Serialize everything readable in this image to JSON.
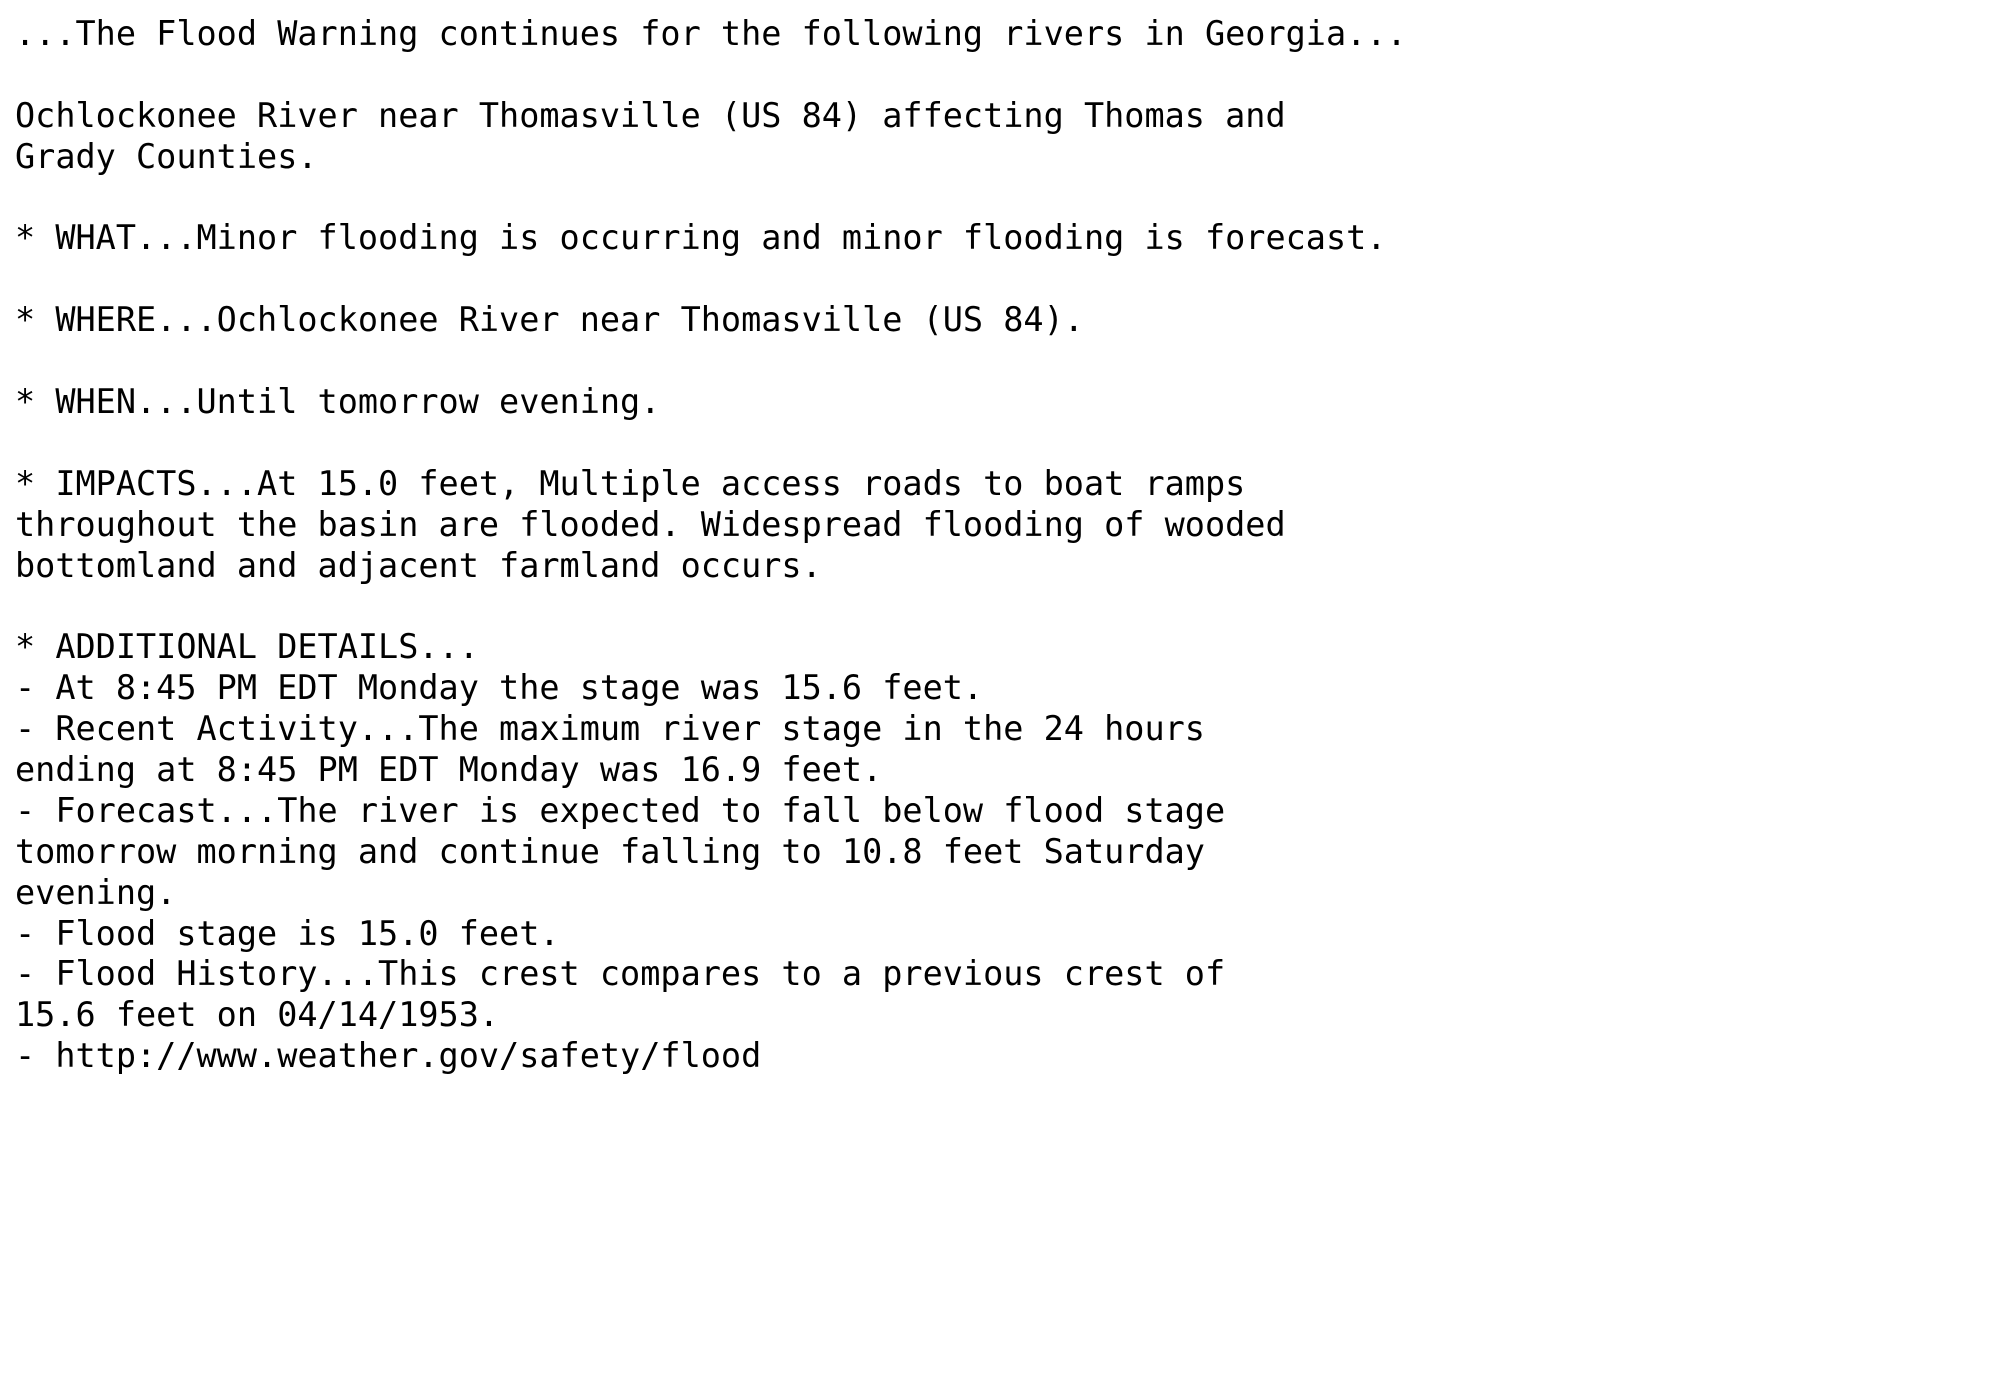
{
  "document": {
    "kind": "nws-flood-warning-bulletin",
    "background_color": "#ffffff",
    "text_color": "#000000",
    "headline": "...The Flood Warning continues for the following rivers in Georgia...",
    "river_location": "Ochlockonee River near Thomasville (US 84) affecting Thomas and Grady Counties.",
    "sections": {
      "what": "* WHAT...Minor flooding is occurring and minor flooding is forecast.",
      "where": "* WHERE...Ochlockonee River near Thomasville (US 84).",
      "when": "* WHEN...Until tomorrow evening.",
      "impacts": "* IMPACTS...At 15.0 feet, Multiple access roads to boat ramps throughout the basin are flooded. Widespread flooding of wooded bottomland and adjacent farmland occurs.",
      "additional_details_header": "* ADDITIONAL DETAILS...",
      "additional_details": [
        "- At 8:45 PM EDT Monday the stage was 15.6 feet.",
        "- Recent Activity...The maximum river stage in the 24 hours ending at 8:45 PM EDT Monday was 16.9 feet.",
        "- Forecast...The river is expected to fall below flood stage tomorrow morning and continue falling to 10.8 feet Saturday evening.",
        "- Flood stage is 15.0 feet.",
        "- Flood History...This crest compares to a previous crest of 15.6 feet on 04/14/1953.",
        "- http://www.weather.gov/safety/flood"
      ]
    },
    "values": {
      "flood_stage_feet": "15.0",
      "current_stage_feet": "15.6",
      "max_stage_24h_feet": "16.9",
      "forecast_stage_feet": "10.8",
      "previous_crest_feet": "15.6",
      "previous_crest_date": "04/14/1953",
      "observation_time": "8:45 PM EDT Monday",
      "forecast_day": "Saturday evening",
      "impact_stage_feet": "15.0",
      "recent_activity_window": "24 hours",
      "route": "US 84",
      "state": "Georgia",
      "counties": "Thomas and Grady Counties",
      "url": "http://www.weather.gov/safety/flood"
    },
    "lines": [
      "...The Flood Warning continues for the following rivers in Georgia...",
      "",
      "Ochlockonee River near Thomasville (US 84) affecting Thomas and",
      "Grady Counties.",
      "",
      "* WHAT...Minor flooding is occurring and minor flooding is forecast.",
      "",
      "* WHERE...Ochlockonee River near Thomasville (US 84).",
      "",
      "* WHEN...Until tomorrow evening.",
      "",
      "* IMPACTS...At 15.0 feet, Multiple access roads to boat ramps",
      "throughout the basin are flooded. Widespread flooding of wooded",
      "bottomland and adjacent farmland occurs.",
      "",
      "* ADDITIONAL DETAILS...",
      "- At 8:45 PM EDT Monday the stage was 15.6 feet.",
      "- Recent Activity...The maximum river stage in the 24 hours",
      "ending at 8:45 PM EDT Monday was 16.9 feet.",
      "- Forecast...The river is expected to fall below flood stage",
      "tomorrow morning and continue falling to 10.8 feet Saturday",
      "evening.",
      "- Flood stage is 15.0 feet.",
      "- Flood History...This crest compares to a previous crest of",
      "15.6 feet on 04/14/1953.",
      "- http://www.weather.gov/safety/flood"
    ]
  }
}
